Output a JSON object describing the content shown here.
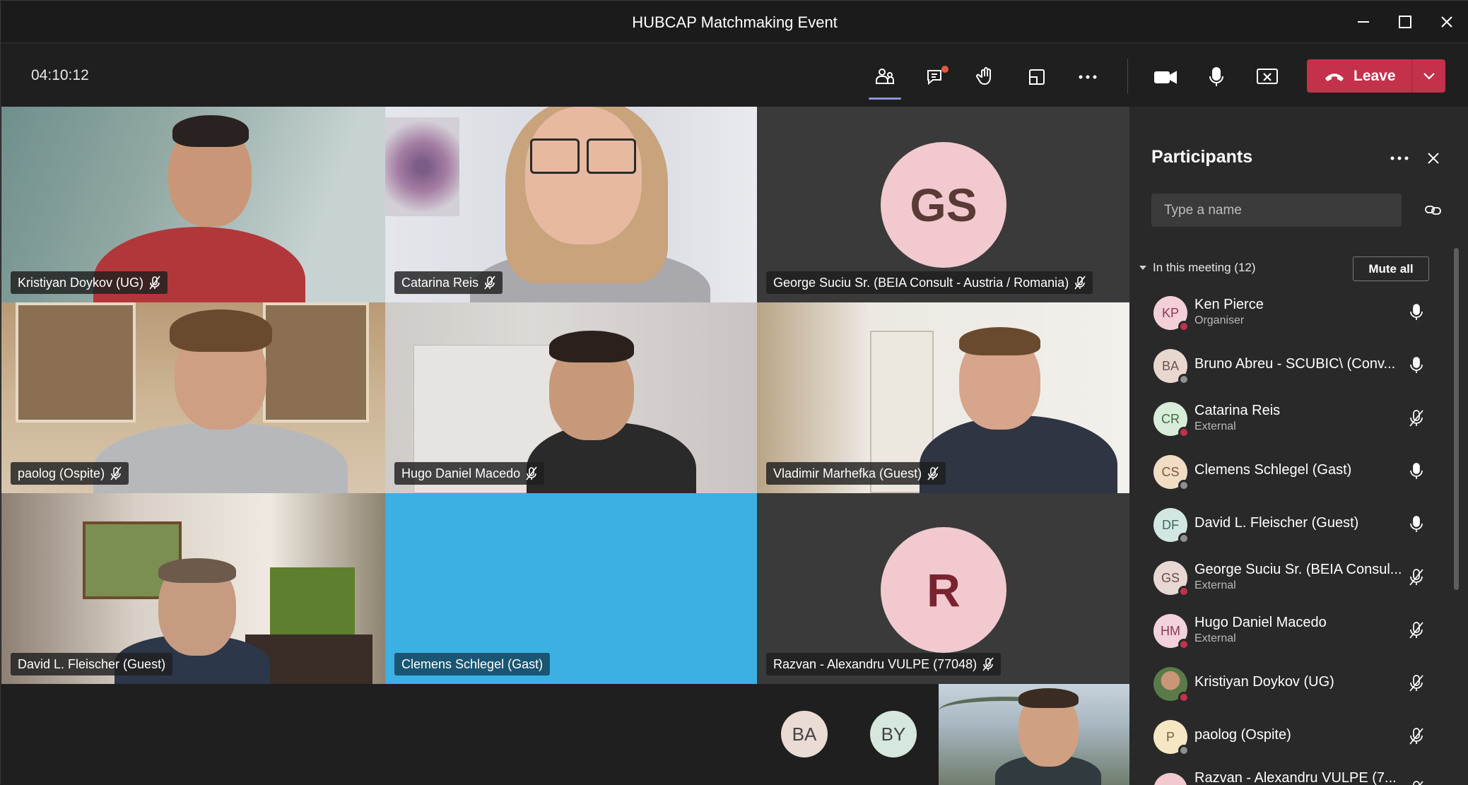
{
  "window": {
    "title": "HUBCAP Matchmaking Event",
    "controls": [
      "minimize-icon",
      "maximize-icon",
      "close-icon"
    ]
  },
  "toolbar": {
    "timer": "04:10:12",
    "buttons": [
      "participants-icon",
      "chat-icon",
      "raise-hand-icon",
      "share-tray-icon",
      "more-options-icon",
      "camera-icon",
      "microphone-icon",
      "stop-sharing-icon"
    ],
    "leave_label": "Leave",
    "leave_color": "#c4314b"
  },
  "tiles": [
    {
      "name": "Kristiyan Doykov (UG)",
      "muted": true
    },
    {
      "name": "Catarina Reis",
      "muted": true
    },
    {
      "name": "George Suciu Sr. (BEIA Consult - Austria / Romania)",
      "muted": true,
      "initials": "GS"
    },
    {
      "name": "paolog (Ospite)",
      "muted": true
    },
    {
      "name": "Hugo Daniel Macedo",
      "muted": true
    },
    {
      "name": "Vladimir Marhefka (Guest)",
      "muted": true
    },
    {
      "name": "David L. Fleischer (Guest)",
      "muted": false
    },
    {
      "name": "Clemens Schlegel (Gast)",
      "muted": false,
      "bg": "#3cb0e2"
    },
    {
      "name": "Razvan - Alexandru VULPE (77048)",
      "muted": true,
      "initials": "R"
    }
  ],
  "strip": {
    "avatars": [
      "BA",
      "BY"
    ]
  },
  "panel": {
    "title": "Participants",
    "search_placeholder": "Type a name",
    "section_label": "In this meeting (12)",
    "mute_all_label": "Mute all",
    "participants": [
      {
        "initials": "KP",
        "name": "Ken Pierce",
        "role": "Organiser",
        "mic": "on",
        "status": "busy"
      },
      {
        "initials": "BA",
        "name": "Bruno Abreu - SCUBIC\\ (Conv...",
        "role": "",
        "mic": "on",
        "status": "away"
      },
      {
        "initials": "CR",
        "name": "Catarina Reis",
        "role": "External",
        "mic": "muted",
        "status": "busy"
      },
      {
        "initials": "CS",
        "name": "Clemens Schlegel (Gast)",
        "role": "",
        "mic": "on",
        "status": "away"
      },
      {
        "initials": "DF",
        "name": "David L. Fleischer (Guest)",
        "role": "",
        "mic": "on",
        "status": "away"
      },
      {
        "initials": "GS",
        "name": "George Suciu Sr. (BEIA Consul...",
        "role": "External",
        "mic": "muted",
        "status": "busy"
      },
      {
        "initials": "HM",
        "name": "Hugo Daniel Macedo",
        "role": "External",
        "mic": "muted",
        "status": "busy"
      },
      {
        "initials": "",
        "name": "Kristiyan Doykov (UG)",
        "role": "",
        "mic": "muted",
        "status": "busy"
      },
      {
        "initials": "P",
        "name": "paolog (Ospite)",
        "role": "",
        "mic": "muted",
        "status": "away"
      },
      {
        "initials": "",
        "name": "Razvan - Alexandru VULPE (7...",
        "role": "",
        "mic": "muted",
        "status": "away"
      }
    ]
  }
}
